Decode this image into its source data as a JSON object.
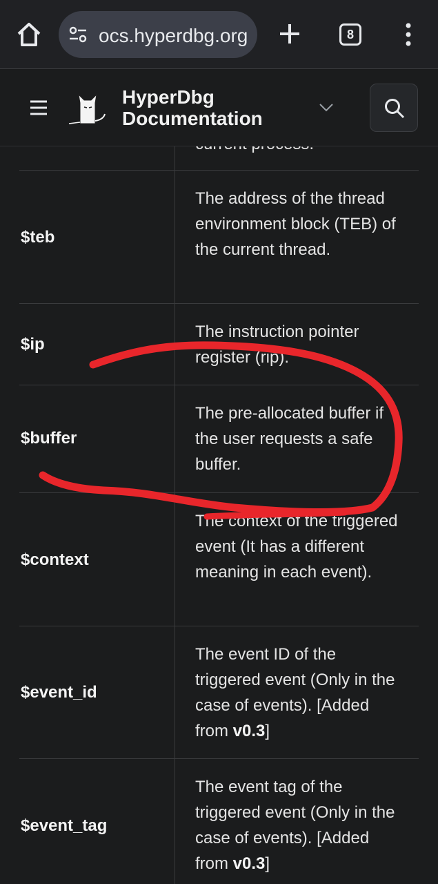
{
  "browser": {
    "url": "ocs.hyperdbg.org",
    "tab_count": "8"
  },
  "header": {
    "title_line1": "HyperDbg",
    "title_line2": "Documentation"
  },
  "table": {
    "prev_desc_tail": "current process.",
    "rows": [
      {
        "name": "$teb",
        "desc": "The address of the thread environment block (TEB) of the current thread."
      },
      {
        "name": "$ip",
        "desc": "The instruction pointer register (rip)."
      },
      {
        "name": "$buffer",
        "desc": "The pre-allocated buffer if the user requests a safe buffer."
      },
      {
        "name": "$context",
        "desc": "The context of the triggered event (It has a different meaning in each event)."
      },
      {
        "name": "$event_id",
        "desc": "The event ID of the triggered event (Only in the case of events).",
        "added_prefix": "[Added from ",
        "added_version": "v0.3",
        "added_suffix": "]"
      },
      {
        "name": "$event_tag",
        "desc": "The event tag of the triggered event (Only in the case of events).",
        "added_prefix": "[Added from ",
        "added_version": "v0.3",
        "added_suffix": "]"
      }
    ]
  },
  "colors": {
    "annotation": "#e8262b",
    "background": "#1b1c1d"
  }
}
